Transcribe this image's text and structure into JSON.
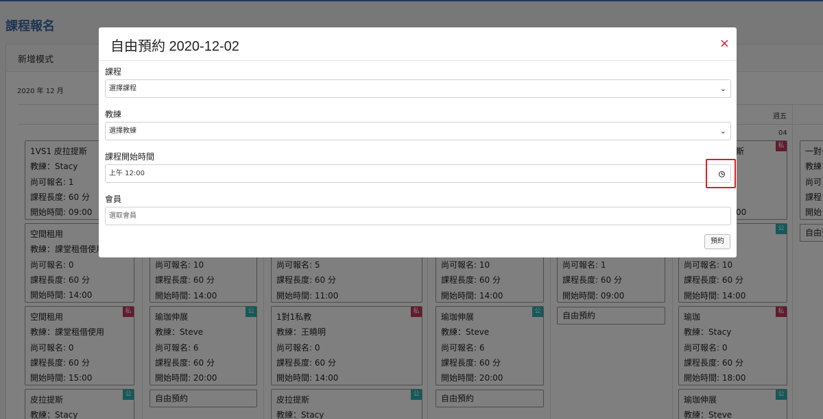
{
  "page": {
    "title": "課程報名"
  },
  "panel": {
    "header": "新增模式",
    "month_label": "2020 年 12 月"
  },
  "calendar": {
    "weekday_label": "週五",
    "day_number": "04",
    "cards": [
      {
        "title": "1VS1 皮拉提斯",
        "coach": "教練：Stacy",
        "remaining": "尚可報名: 1",
        "length": "課程長度: 60 分",
        "start": "開始時間: 09:00"
      },
      {
        "title": "空間租用",
        "coach": "教練：課堂租借使用",
        "remaining": "尚可報名: 0",
        "length": "課程長度: 60 分",
        "start": "開始時間: 14:00"
      },
      {
        "title": "空間租用",
        "coach": "教練：課堂租借使用",
        "remaining": "尚可報名: 0",
        "length": "課程長度: 60 分",
        "start": "開始時間: 15:00",
        "badge": "私"
      },
      {
        "title": "皮拉提斯",
        "coach": "教練：Stacy",
        "badge": "公"
      },
      {
        "remaining": "尚可報名: 10",
        "length": "課程長度: 60 分",
        "start": "開始時間: 14:00"
      },
      {
        "title": "瑜珈伸展",
        "coach": "教練：Steve",
        "remaining": "尚可報名: 6",
        "length": "課程長度: 60 分",
        "start": "開始時間: 20:00",
        "badge": "公"
      },
      {
        "remaining": "尚可報名: 5",
        "length": "課程長度: 60 分",
        "start": "開始時間: 11:00"
      },
      {
        "title": "1對1私教",
        "coach": "教練：王曉明",
        "remaining": "尚可報名: 0",
        "length": "課程長度: 60 分",
        "start": "開始時間: 14:00",
        "badge": "私"
      },
      {
        "title": "皮拉提斯",
        "coach": "教練：Stacy",
        "badge": "公"
      },
      {
        "remaining": "尚可報名: 10",
        "length": "課程長度: 60 分",
        "start": "開始時間: 14:00"
      },
      {
        "title": "瑜珈伸展",
        "coach": "教練：Steve",
        "remaining": "尚可報名: 6",
        "length": "課程長度: 60 分",
        "start": "開始時間: 20:00",
        "badge": "公"
      },
      {
        "remaining": "尚可報名: 1",
        "length": "課程長度: 60 分",
        "start": "開始時間: 09:00"
      },
      {
        "title_suffix": "斯",
        "badge_top": "私",
        "end_suffix": "00"
      },
      {
        "remaining": "尚可報名: 10",
        "length": "課程長度: 60 分",
        "start": "開始時間: 14:00",
        "badge": "公"
      },
      {
        "title": "瑜珈",
        "coach": "教練：Stacy",
        "remaining": "尚可報名: 0",
        "length": "課程長度: 60 分",
        "start": "開始時間: 18:00",
        "badge": "私"
      },
      {
        "title": "瑜珈伸展",
        "coach": "教練：Steve",
        "badge": "公"
      },
      {
        "title": "一對一",
        "coach": "教練",
        "remaining": "尚可",
        "length": "課程",
        "start": "開始"
      }
    ],
    "free_label": "自由預約",
    "free_partial": "自由預"
  },
  "modal": {
    "title": "自由預約 2020-12-02",
    "close_glyph": "×",
    "course": {
      "label": "課程",
      "placeholder": "選擇課程"
    },
    "coach": {
      "label": "教練",
      "placeholder": "選擇教練"
    },
    "start_time": {
      "label": "課程開始時間",
      "value": "上午 12:00"
    },
    "member": {
      "label": "會員",
      "placeholder": "選取會員"
    },
    "submit_label": "預約"
  },
  "colors": {
    "private_badge": "#c8345c",
    "public_badge": "#2bb3b3",
    "accent": "#3b6aa8",
    "close": "#d0202e",
    "highlight": "#e01c24"
  }
}
